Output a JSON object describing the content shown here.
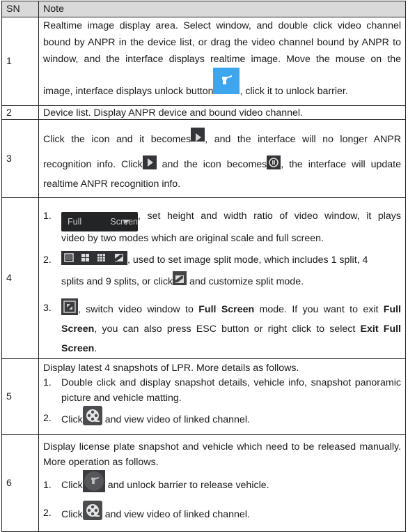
{
  "header": {
    "sn": "SN",
    "note": "Note"
  },
  "rows": [
    {
      "sn": "1",
      "line1": "Realtime image display area. Select window, and double click video channel bound by ANPR in the device list, or drag the video channel bound by ANPR to window, and the interface displays realtime image. Move the mouse on the",
      "line2a": "image, interface displays unlock button",
      "line2b": ", click it to unlock barrier.",
      "icon": "unlock-barrier-icon"
    },
    {
      "sn": "2",
      "text": "Device list. Display ANPR device and bound video channel."
    },
    {
      "sn": "3",
      "a": "Click the icon and it becomes",
      "b": ", and the interface will no longer ANPR",
      "c": "recognition info. Click",
      "d": " and the icon becomes",
      "e": ", the interface will update",
      "f": "realtime ANPR recognition info."
    },
    {
      "sn": "4",
      "items": [
        {
          "num": "1.",
          "dropdown_label": "Full Screen",
          "text1": ", set height and width ratio of video window, it plays",
          "text2": "video by two modes which are original scale and full screen."
        },
        {
          "num": "2.",
          "text1": ", used to set image split mode, which includes 1 split, 4",
          "text2a": "splits and 9 splits, or click",
          "text2b": " and customize split mode."
        },
        {
          "num": "3.",
          "t1": ", switch video window to ",
          "b1": "Full Screen",
          "t2": " mode. If you want to exit ",
          "b2": "Full Screen",
          "t3": ", you can also press ESC button or right click to select ",
          "b3": "Exit Full Screen",
          "t4": "."
        }
      ]
    },
    {
      "sn": "5",
      "intro": "Display latest 4 snapshots of LPR. More details as follows.",
      "items": [
        {
          "num": "1.",
          "text": "Double click and display snapshot details, vehicle info, snapshot panoramic picture and vehicle matting."
        },
        {
          "num": "2.",
          "a": "Click",
          "b": " and view video of linked channel."
        }
      ]
    },
    {
      "sn": "6",
      "intro": "Display license plate snapshot and vehicle which need to be released manually. More operation as follows.",
      "items": [
        {
          "num": "1.",
          "a": "Click",
          "b": " and unlock barrier to release vehicle."
        },
        {
          "num": "2.",
          "a": "Click",
          "b": " and view video of linked channel."
        }
      ]
    }
  ],
  "colors": {
    "header_bg": "#d9d9d9",
    "unlock_blue": "#3ea6ef",
    "icon_dark": "#333538"
  }
}
